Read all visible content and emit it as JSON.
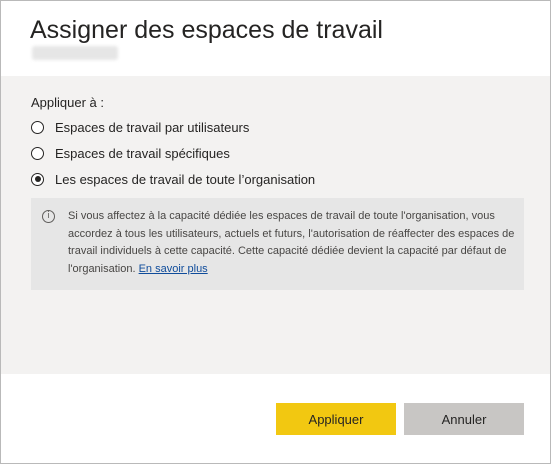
{
  "dialog": {
    "title": "Assigner des espaces de travail"
  },
  "options": {
    "label": "Appliquer à :",
    "items": [
      {
        "label": "Espaces de travail par utilisateurs",
        "checked": false
      },
      {
        "label": "Espaces de travail spécifiques",
        "checked": false
      },
      {
        "label": "Les espaces de travail de toute l’organisation",
        "checked": true
      }
    ]
  },
  "info": {
    "icon": "info-icon",
    "text": "Si vous affectez à la capacité dédiée les espaces de travail de toute l'organisation, vous accordez à tous les utilisateurs, actuels et futurs, l'autorisation de réaffecter des espaces de travail individuels à cette capacité. Cette capacité dédiée devient la capacité par défaut de l'organisation. ",
    "link_label": "En savoir plus"
  },
  "footer": {
    "apply_label": "Appliquer",
    "cancel_label": "Annuler"
  },
  "colors": {
    "primary_button": "#f2c811",
    "secondary_button": "#c8c6c4",
    "body_background": "#f3f2f1",
    "info_background": "#e6e6e6",
    "link": "#0f4c9b"
  }
}
